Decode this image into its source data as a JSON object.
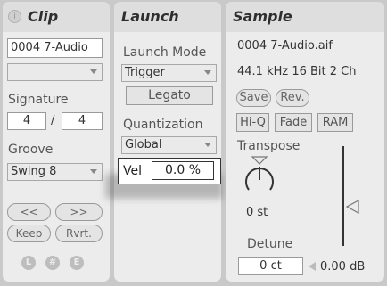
{
  "clip": {
    "title": "Clip",
    "sample_name": "0004 7-Audio",
    "signature_label": "Signature",
    "signature_num": "4",
    "signature_sep": "/",
    "signature_den": "4",
    "groove_label": "Groove",
    "groove_value": "Swing 8",
    "nudge_left": "<<",
    "nudge_right": ">>",
    "keep": "Keep",
    "rvrt": "Rvrt.",
    "icon_l": "L",
    "icon_e": "E"
  },
  "launch": {
    "title": "Launch",
    "mode_label": "Launch Mode",
    "mode_value": "Trigger",
    "legato": "Legato",
    "quant_label": "Quantization",
    "quant_value": "Global",
    "vel_label": "Vel",
    "vel_value": "0.0 %"
  },
  "sample": {
    "title": "Sample",
    "file_name": "0004 7-Audio.aif",
    "file_info": "44.1 kHz 16 Bit 2 Ch",
    "save": "Save",
    "rev": "Rev.",
    "hiq": "Hi-Q",
    "fade": "Fade",
    "ram": "RAM",
    "transpose_label": "Transpose",
    "transpose_value": "0 st",
    "detune_label": "Detune",
    "detune_value": "0 ct",
    "gain_value": "0.00 dB"
  }
}
